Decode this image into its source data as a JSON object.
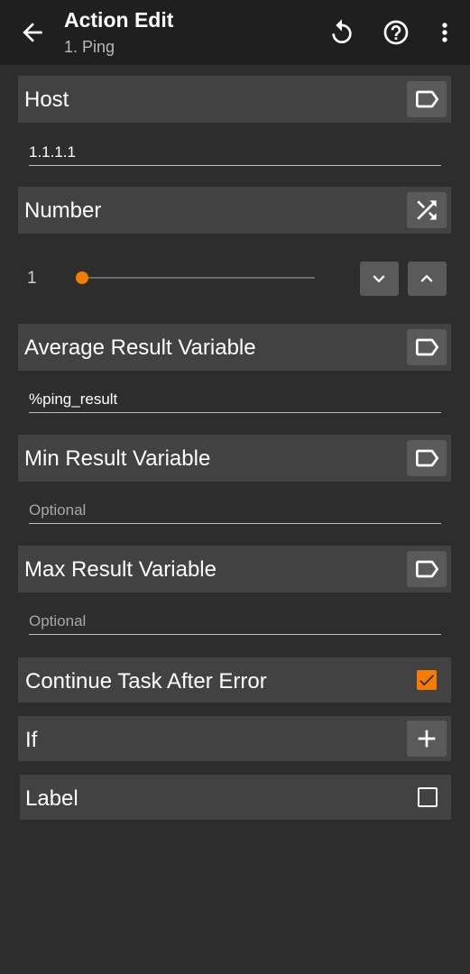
{
  "appbar": {
    "title": "Action Edit",
    "subtitle": "1. Ping",
    "icons": [
      "back-arrow-icon",
      "reset-icon",
      "help-icon",
      "more-vert-icon"
    ]
  },
  "host": {
    "label": "Host",
    "value": "1.1.1.1",
    "icon": "label-tag-icon"
  },
  "number": {
    "label": "Number",
    "value": "1",
    "slider_fraction": 0.0,
    "icon": "shuffle-icon",
    "decrement_icon": "chevron-down-icon",
    "increment_icon": "chevron-up-icon"
  },
  "average_result": {
    "label": "Average Result Variable",
    "value": "%ping_result",
    "icon": "label-tag-icon"
  },
  "min_result": {
    "label": "Min Result Variable",
    "placeholder": "Optional",
    "icon": "label-tag-icon"
  },
  "max_result": {
    "label": "Max Result Variable",
    "placeholder": "Optional",
    "icon": "label-tag-icon"
  },
  "continue_after_error": {
    "label": "Continue Task After Error",
    "checked": true
  },
  "if_block": {
    "label": "If",
    "icon": "plus-icon"
  },
  "label_block": {
    "label": "Label",
    "checked": false
  },
  "colors": {
    "background": "#2d2d2d",
    "appbar": "#1f1f1f",
    "section": "#424242",
    "button": "#5a5a5a",
    "accent": "#f57c00"
  }
}
